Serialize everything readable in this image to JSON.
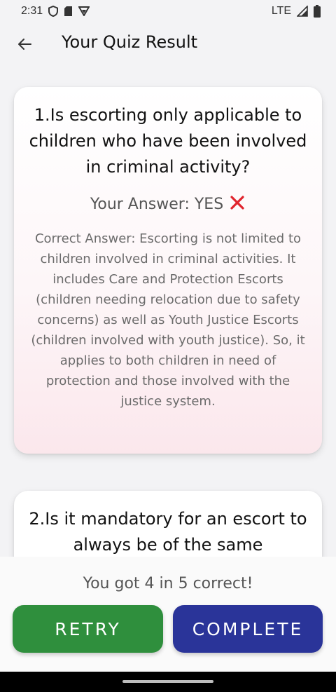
{
  "status_bar": {
    "time": "2:31",
    "network": "LTE"
  },
  "app_bar": {
    "title": "Your Quiz Result"
  },
  "questions": [
    {
      "text": "1.Is escorting only applicable to children who have been involved in criminal activity?",
      "your_answer_label": "Your Answer: YES",
      "result_icon": "cross-mark-icon",
      "correct_answer": "Correct Answer: Escorting is not limited to children involved in criminal activities. It includes Care and Protection Escorts (children needing relocation due to safety concerns) as well as Youth Justice Escorts (children involved with youth justice). So, it applies to both children in need of protection and those involved with the justice system."
    },
    {
      "text": "2.Is it mandatory for an escort to always be of the same"
    }
  ],
  "summary": {
    "score_text": "You got 4 in 5 correct!"
  },
  "actions": {
    "retry_label": "RETRY",
    "complete_label": "COMPLETE"
  },
  "colors": {
    "retry": "#2f8f3d",
    "complete": "#2a3499",
    "wrong": "#e0242d"
  }
}
